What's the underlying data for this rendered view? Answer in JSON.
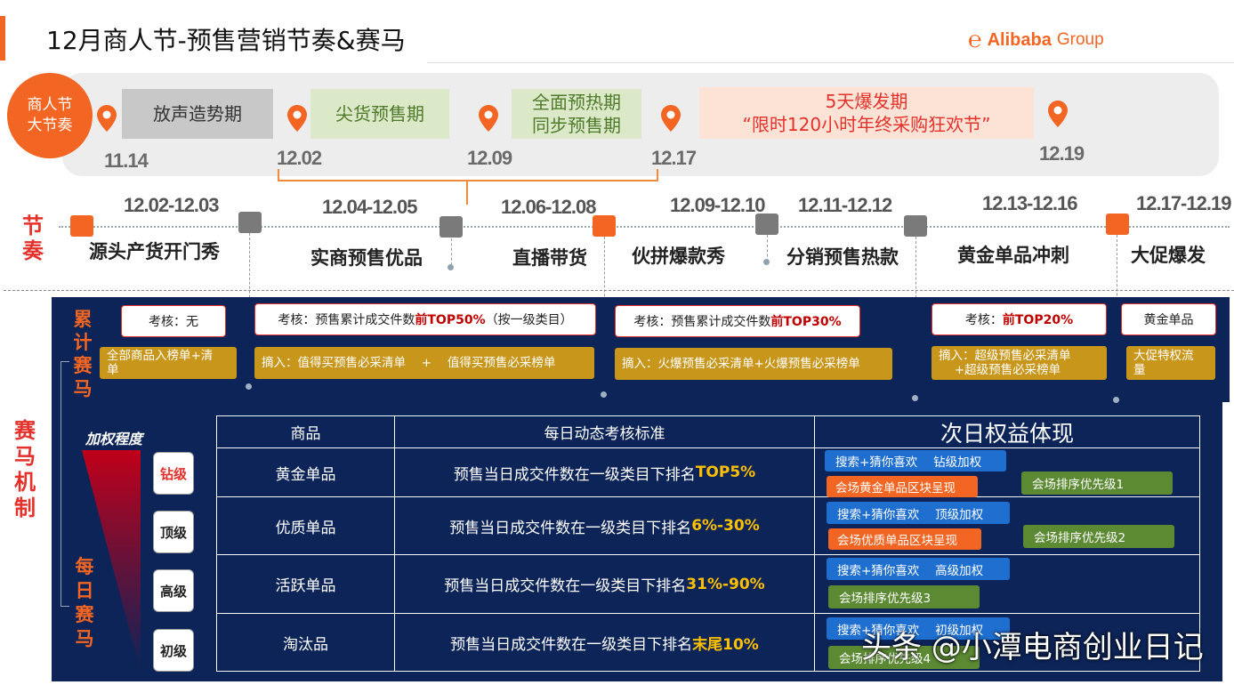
{
  "header": {
    "title": "12月商人节-预售营销节奏&赛马",
    "logo_text": "Alibaba",
    "logo_sub": "Group"
  },
  "colors": {
    "accent": "#f26522",
    "navy": "#0c2458",
    "gold": "#c8961a",
    "blue": "#1f6fd1",
    "green": "#5b8a32",
    "red": "#e4312b"
  },
  "timeline": {
    "major_label_line1": "商人节",
    "major_label_line2": "大节奏",
    "phases": [
      {
        "line1": "放声造势期",
        "line2": ""
      },
      {
        "line1": "尖货预售期",
        "line2": ""
      },
      {
        "line1": "全面预热期",
        "line2": "同步预售期"
      },
      {
        "line1": "5天爆发期",
        "line2": "“限时120小时年终采购狂欢节”"
      }
    ],
    "dates": [
      "11.14",
      "12.02",
      "12.09",
      "12.17",
      "12.19"
    ]
  },
  "rhythm": {
    "label_chars": [
      "节",
      "奏"
    ],
    "items": [
      {
        "date": "12.02-12.03",
        "name": "源头产货开门秀"
      },
      {
        "date": "12.04-12.05",
        "name": "实商预售优品"
      },
      {
        "date": "12.06-12.08",
        "name": "直播带货"
      },
      {
        "date": "12.09-12.10",
        "name": "伙拼爆款秀"
      },
      {
        "date": "12.11-12.12",
        "name": "分销预售热款"
      },
      {
        "date": "12.13-12.16",
        "name": "黄金单品冲刺"
      },
      {
        "date": "12.17-12.19",
        "name": "大促爆发"
      }
    ]
  },
  "race": {
    "mechanism_chars": [
      "赛",
      "马",
      "机",
      "制"
    ],
    "cumulative_chars": [
      "累",
      "计",
      "赛",
      "马"
    ],
    "daily_chars": [
      "每",
      "日",
      "赛",
      "马"
    ],
    "assessments": [
      {
        "prefix": "考核：无",
        "bold": "",
        "suffix": ""
      },
      {
        "prefix": "考核：预售累计成交件数",
        "bold": "前TOP50%",
        "suffix": "（按一级类目）"
      },
      {
        "prefix": "考核：预售累计成交件数",
        "bold": "前TOP30%",
        "suffix": ""
      },
      {
        "prefix": "考核：",
        "bold": "前TOP20%",
        "suffix": ""
      },
      {
        "prefix": "黄金单品",
        "bold": "",
        "suffix": ""
      }
    ],
    "benefits": [
      {
        "line1": "全部商品入榜单+清",
        "line2": "单"
      },
      {
        "line1": "摘入：值得买预售必采清单　 +　 值得买预售必采榜单",
        "line2": ""
      },
      {
        "line1": "摘入：火爆预售必采清单+火爆预售必采榜单",
        "line2": ""
      },
      {
        "line1": "摘入：超级预售必采清单",
        "line2": "　 +超级预售必采榜单"
      },
      {
        "line1": "大促特权流",
        "line2": "量"
      }
    ]
  },
  "daily": {
    "weight_label": "加权程度",
    "levels": [
      "钻级",
      "顶级",
      "高级",
      "初级"
    ],
    "table_headers": [
      "商品",
      "每日动态考核标准",
      "次日权益体现"
    ],
    "rows": [
      {
        "product": "黄金单品",
        "standard_prefix": "预售当日成交件数在一级类目下排名",
        "standard_bold": "TOP5%",
        "blue": "搜索+猜你喜欢　 钻级加权",
        "orange": "会场黄金单品区块呈现",
        "green": "会场排序优先级1"
      },
      {
        "product": "优质单品",
        "standard_prefix": "预售当日成交件数在一级类目下排名",
        "standard_bold": "6%-30%",
        "blue": "搜索+猜你喜欢　 顶级加权",
        "orange": "会场优质单品区块呈现",
        "green": "会场排序优先级2"
      },
      {
        "product": "活跃单品",
        "standard_prefix": "预售当日成交件数在一级类目下排名",
        "standard_bold": "31%-90%",
        "blue": "搜索+猜你喜欢　 高级加权",
        "orange": "",
        "green": "会场排序优先级3"
      },
      {
        "product": "淘汰品",
        "standard_prefix": "预售当日成交件数在一级类目下排名",
        "standard_bold": "末尾10%",
        "blue": "搜索+猜你喜欢　 初级加权",
        "orange": "",
        "green": "会场排序优先级4"
      }
    ]
  },
  "watermark": "头条 @小潭电商创业日记"
}
